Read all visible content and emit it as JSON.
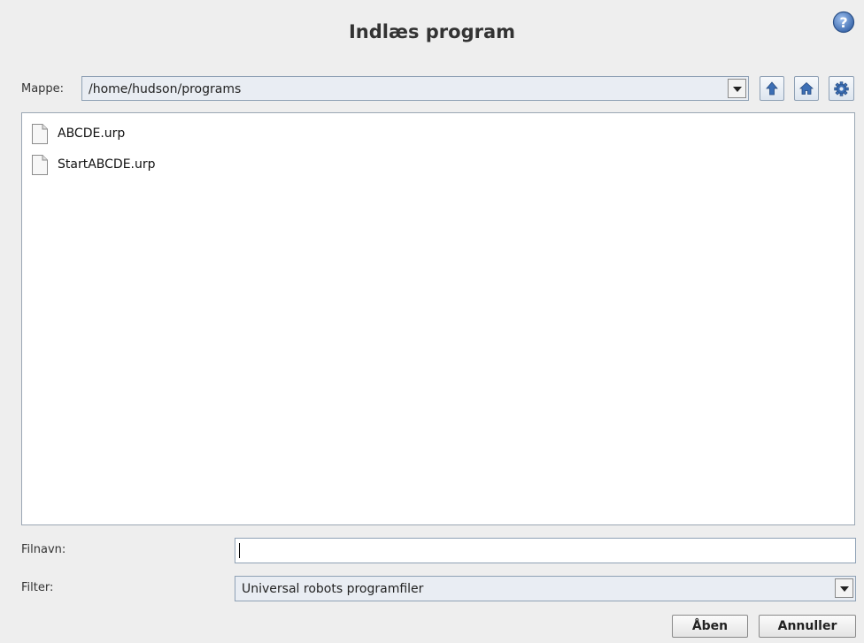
{
  "dialog": {
    "title": "Indlæs program",
    "help_icon": "help-icon"
  },
  "folder": {
    "label": "Mappe:",
    "path": "/home/hudson/programs",
    "icons": [
      "chevron-down-icon",
      "up-arrow-icon",
      "home-icon",
      "gear-icon"
    ]
  },
  "files": [
    {
      "name": "ABCDE.urp",
      "icon": "file-icon"
    },
    {
      "name": "StartABCDE.urp",
      "icon": "file-icon"
    }
  ],
  "filename": {
    "label": "Filnavn:",
    "value": ""
  },
  "filter": {
    "label": "Filter:",
    "selected": "Universal robots programfiler"
  },
  "buttons": {
    "open_label": "Åben",
    "cancel_label": "Annuller"
  },
  "colors": {
    "background": "#eeeeee",
    "accent_blue": "#3c6fb5",
    "field_border": "#8fa1b5"
  }
}
